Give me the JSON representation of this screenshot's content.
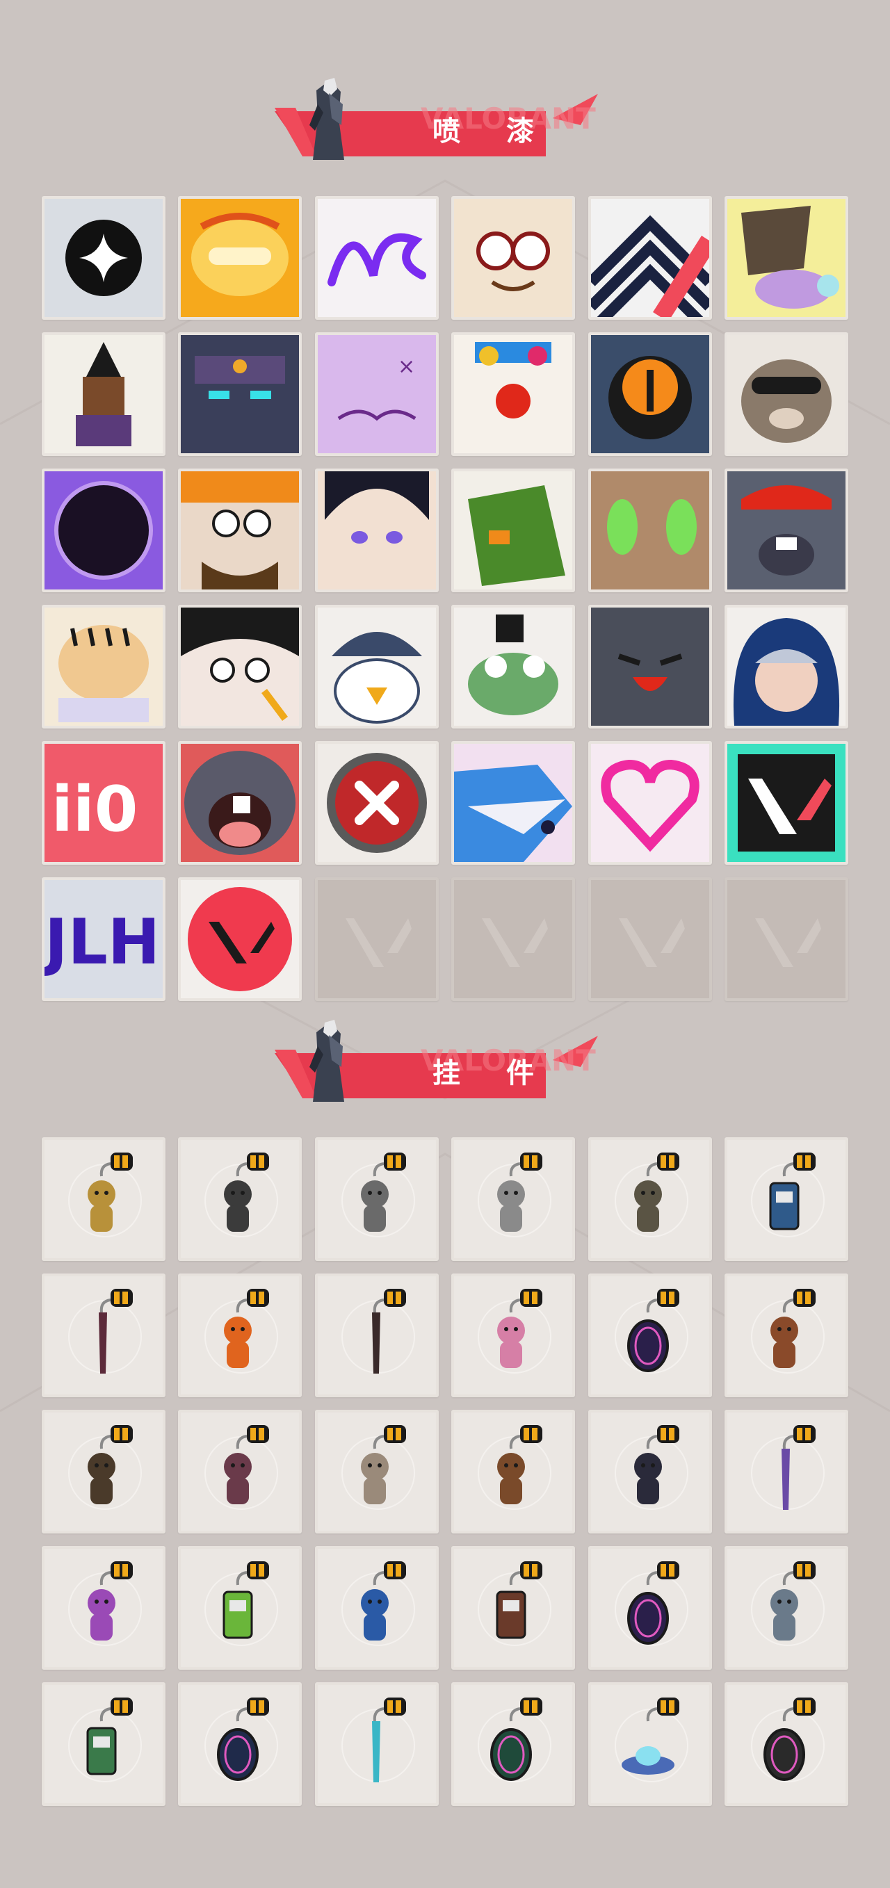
{
  "sections": {
    "sprays": {
      "title": "喷 漆"
    },
    "buddies": {
      "title": "挂 件"
    }
  },
  "watermark_text": "VALORANT",
  "colors": {
    "background": "#cbc4c1",
    "banner_red": "#f04a5a",
    "tile": "#efebe7",
    "empty_tile": "#c4bbb6"
  },
  "sprays": [
    {
      "icon": "star-emblem-icon"
    },
    {
      "icon": "golden-mask-icon"
    },
    {
      "icon": "purple-graffiti-icon"
    },
    {
      "icon": "goggles-cat-icon"
    },
    {
      "icon": "chevron-stripes-icon"
    },
    {
      "icon": "cute-cat-icon"
    },
    {
      "icon": "pixel-agent-icon"
    },
    {
      "icon": "robot-face-icon"
    },
    {
      "icon": "purple-blob-icon"
    },
    {
      "icon": "clown-face-icon"
    },
    {
      "icon": "orange-button-icon"
    },
    {
      "icon": "raccoon-icon"
    },
    {
      "icon": "void-orb-icon"
    },
    {
      "icon": "bandana-guy-icon"
    },
    {
      "icon": "anime-boy-icon"
    },
    {
      "icon": "green-box-icon"
    },
    {
      "icon": "green-eyes-icon"
    },
    {
      "icon": "crying-mole-icon"
    },
    {
      "icon": "tiger-icon"
    },
    {
      "icon": "girl-pencil-icon"
    },
    {
      "icon": "penguin-icon"
    },
    {
      "icon": "frog-hat-icon"
    },
    {
      "icon": "grey-creature-icon"
    },
    {
      "icon": "hooded-agent-icon"
    },
    {
      "icon": "score-ii0-icon"
    },
    {
      "icon": "yelling-mole-icon"
    },
    {
      "icon": "red-x-icon"
    },
    {
      "icon": "shark-icon"
    },
    {
      "icon": "neon-heart-icon"
    },
    {
      "icon": "valorant-logo-icon"
    },
    {
      "icon": "blue-graffiti-icon"
    },
    {
      "icon": "red-valorant-icon"
    },
    {
      "icon": "empty-slot-icon"
    },
    {
      "icon": "empty-slot-icon"
    },
    {
      "icon": "empty-slot-icon"
    },
    {
      "icon": "empty-slot-icon"
    }
  ],
  "buddies": [
    {
      "icon": "gold-cat-charm-icon",
      "color": "#b8913a"
    },
    {
      "icon": "drone-charm-icon",
      "color": "#3b3b3b"
    },
    {
      "icon": "pot-charm-icon",
      "color": "#6a6a6a"
    },
    {
      "icon": "armored-cat-charm-icon",
      "color": "#8a8a8a"
    },
    {
      "icon": "satchel-charm-icon",
      "color": "#5a5444"
    },
    {
      "icon": "canister-charm-icon",
      "color": "#2f5a8a"
    },
    {
      "icon": "chainsaw-charm-icon",
      "color": "#5c2a3a"
    },
    {
      "icon": "chili-charm-icon",
      "color": "#e0641e"
    },
    {
      "icon": "rope-charm-icon",
      "color": "#3a2a2a"
    },
    {
      "icon": "cupcake-charm-icon",
      "color": "#d67fa6"
    },
    {
      "icon": "ep9-badge-charm-icon",
      "color": "#2a1f4a"
    },
    {
      "icon": "bear-charm-icon",
      "color": "#8a4a2a"
    },
    {
      "icon": "turret-charm-icon",
      "color": "#4a3a2a"
    },
    {
      "icon": "agent-figure-charm-icon",
      "color": "#6a3a4a"
    },
    {
      "icon": "cowboy-charm-icon",
      "color": "#9a8a7a"
    },
    {
      "icon": "crate-charm-icon",
      "color": "#7a4a2a"
    },
    {
      "icon": "witch-charm-icon",
      "color": "#2a2a3a"
    },
    {
      "icon": "crystal-charm-icon",
      "color": "#6a4aa6"
    },
    {
      "icon": "lava-lamp-charm-icon",
      "color": "#9a4ab6"
    },
    {
      "icon": "pager-charm-icon",
      "color": "#6ab63a"
    },
    {
      "icon": "astronaut-charm-icon",
      "color": "#2a5aa6"
    },
    {
      "icon": "radio-charm-icon",
      "color": "#6a3a2a"
    },
    {
      "icon": "ep9-badge-charm-icon",
      "color": "#2a1f4a"
    },
    {
      "icon": "robot-girl-charm-icon",
      "color": "#6a7a8a"
    },
    {
      "icon": "soda-can-charm-icon",
      "color": "#3a7a4a"
    },
    {
      "icon": "ep9-gold-badge-charm-icon",
      "color": "#1f2a4a"
    },
    {
      "icon": "blue-blade-charm-icon",
      "color": "#3ab6c6"
    },
    {
      "icon": "ep8-badge-charm-icon",
      "color": "#1f4a3a"
    },
    {
      "icon": "ufo-charm-icon",
      "color": "#4a6ab6"
    },
    {
      "icon": "v-medallion-charm-icon",
      "color": "#2a2a2a"
    }
  ]
}
